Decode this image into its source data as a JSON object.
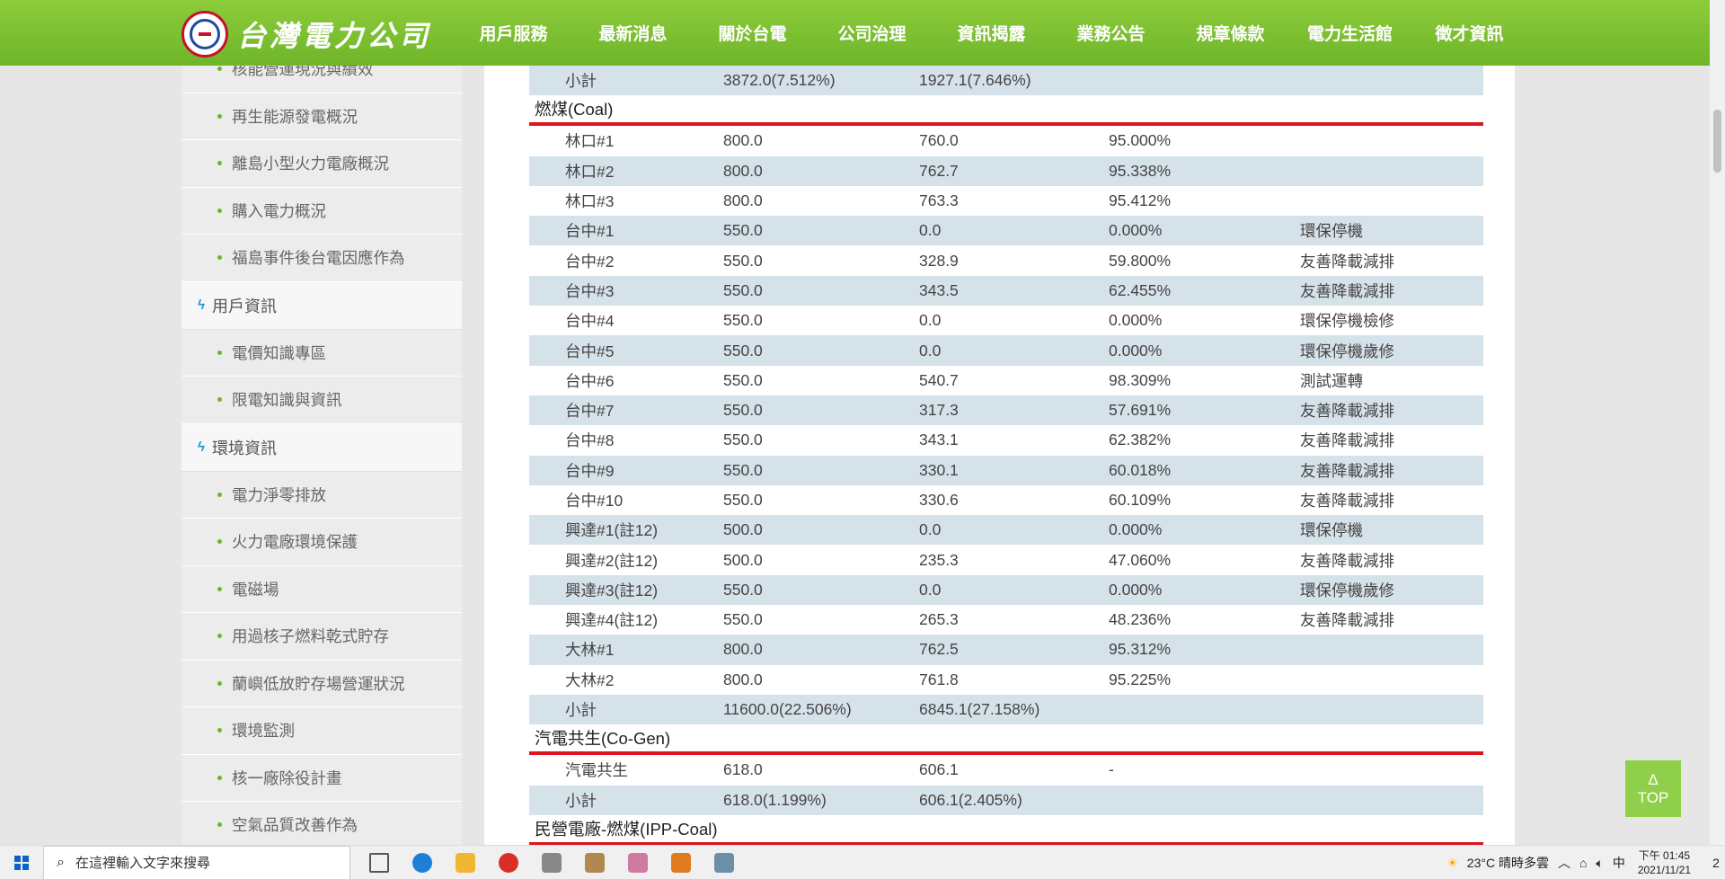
{
  "header": {
    "logo_text": "台灣電力公司",
    "nav": [
      "用戶服務",
      "最新消息",
      "關於台電",
      "公司治理",
      "資訊揭露",
      "業務公告",
      "規章條款",
      "電力生活館",
      "徵才資訊"
    ],
    "active_nav": "資訊揭露"
  },
  "sidebar": {
    "items": [
      {
        "type": "item",
        "label": "核能營運現況與績效"
      },
      {
        "type": "item",
        "label": "再生能源發電概況"
      },
      {
        "type": "item",
        "label": "離島小型火力電廠概況"
      },
      {
        "type": "item",
        "label": "購入電力概況"
      },
      {
        "type": "item",
        "label": "福島事件後台電因應作為"
      },
      {
        "type": "section",
        "label": "用戶資訊"
      },
      {
        "type": "item",
        "label": "電價知識專區"
      },
      {
        "type": "item",
        "label": "限電知識與資訊"
      },
      {
        "type": "section",
        "label": "環境資訊"
      },
      {
        "type": "item",
        "label": "電力淨零排放"
      },
      {
        "type": "item",
        "label": "火力電廠環境保護"
      },
      {
        "type": "item",
        "label": "電磁場"
      },
      {
        "type": "item",
        "label": "用過核子燃料乾式貯存"
      },
      {
        "type": "item",
        "label": "蘭嶼低放貯存場營運狀況"
      },
      {
        "type": "item",
        "label": "環境監測"
      },
      {
        "type": "item",
        "label": "核一廠除役計畫"
      },
      {
        "type": "item",
        "label": "空氣品質改善作為"
      }
    ]
  },
  "table": {
    "blocks": [
      {
        "kind": "row",
        "cells": [
          "小計",
          "3872.0(7.512%)",
          "1927.1(7.646%)",
          "",
          ""
        ]
      },
      {
        "kind": "section",
        "title": "燃煤(Coal)"
      },
      {
        "kind": "row",
        "cells": [
          "林口#1",
          "800.0",
          "760.0",
          "95.000%",
          ""
        ]
      },
      {
        "kind": "row",
        "cells": [
          "林口#2",
          "800.0",
          "762.7",
          "95.338%",
          ""
        ]
      },
      {
        "kind": "row",
        "cells": [
          "林口#3",
          "800.0",
          "763.3",
          "95.412%",
          ""
        ]
      },
      {
        "kind": "row",
        "cells": [
          "台中#1",
          "550.0",
          "0.0",
          "0.000%",
          "環保停機"
        ]
      },
      {
        "kind": "row",
        "cells": [
          "台中#2",
          "550.0",
          "328.9",
          "59.800%",
          "友善降載減排"
        ]
      },
      {
        "kind": "row",
        "cells": [
          "台中#3",
          "550.0",
          "343.5",
          "62.455%",
          "友善降載減排"
        ]
      },
      {
        "kind": "row",
        "cells": [
          "台中#4",
          "550.0",
          "0.0",
          "0.000%",
          "環保停機檢修"
        ]
      },
      {
        "kind": "row",
        "cells": [
          "台中#5",
          "550.0",
          "0.0",
          "0.000%",
          "環保停機歲修"
        ]
      },
      {
        "kind": "row",
        "cells": [
          "台中#6",
          "550.0",
          "540.7",
          "98.309%",
          "測試運轉"
        ]
      },
      {
        "kind": "row",
        "cells": [
          "台中#7",
          "550.0",
          "317.3",
          "57.691%",
          "友善降載減排"
        ]
      },
      {
        "kind": "row",
        "cells": [
          "台中#8",
          "550.0",
          "343.1",
          "62.382%",
          "友善降載減排"
        ]
      },
      {
        "kind": "row",
        "cells": [
          "台中#9",
          "550.0",
          "330.1",
          "60.018%",
          "友善降載減排"
        ]
      },
      {
        "kind": "row",
        "cells": [
          "台中#10",
          "550.0",
          "330.6",
          "60.109%",
          "友善降載減排"
        ]
      },
      {
        "kind": "row",
        "cells": [
          "興達#1(註12)",
          "500.0",
          "0.0",
          "0.000%",
          "環保停機"
        ]
      },
      {
        "kind": "row",
        "cells": [
          "興達#2(註12)",
          "500.0",
          "235.3",
          "47.060%",
          "友善降載減排"
        ]
      },
      {
        "kind": "row",
        "cells": [
          "興達#3(註12)",
          "550.0",
          "0.0",
          "0.000%",
          "環保停機歲修"
        ]
      },
      {
        "kind": "row",
        "cells": [
          "興達#4(註12)",
          "550.0",
          "265.3",
          "48.236%",
          "友善降載減排"
        ]
      },
      {
        "kind": "row",
        "cells": [
          "大林#1",
          "800.0",
          "762.5",
          "95.312%",
          ""
        ]
      },
      {
        "kind": "row",
        "cells": [
          "大林#2",
          "800.0",
          "761.8",
          "95.225%",
          ""
        ]
      },
      {
        "kind": "row",
        "cells": [
          "小計",
          "11600.0(22.506%)",
          "6845.1(27.158%)",
          "",
          ""
        ]
      },
      {
        "kind": "section",
        "title": "汽電共生(Co-Gen)"
      },
      {
        "kind": "row",
        "cells": [
          "汽電共生",
          "618.0",
          "606.1",
          "-",
          ""
        ]
      },
      {
        "kind": "row",
        "cells": [
          "小計",
          "618.0(1.199%)",
          "606.1(2.405%)",
          "",
          ""
        ]
      },
      {
        "kind": "section",
        "title": "民營電廠-燃煤(IPP-Coal)"
      }
    ]
  },
  "top_button": {
    "arrow": "Δ",
    "label": "TOP"
  },
  "taskbar": {
    "search_placeholder": "在這裡輸入文字來搜尋",
    "weather": "23°C  晴時多雲",
    "ime": "中",
    "time": "下午 01:45",
    "date": "2021/11/21",
    "notification_count": "2",
    "app_colors": [
      "#555555",
      "#1e7fd6",
      "#f2b632",
      "#d93025",
      "#888888",
      "#b08850",
      "#d07aa0",
      "#e07b20",
      "#6c8fa8"
    ]
  }
}
